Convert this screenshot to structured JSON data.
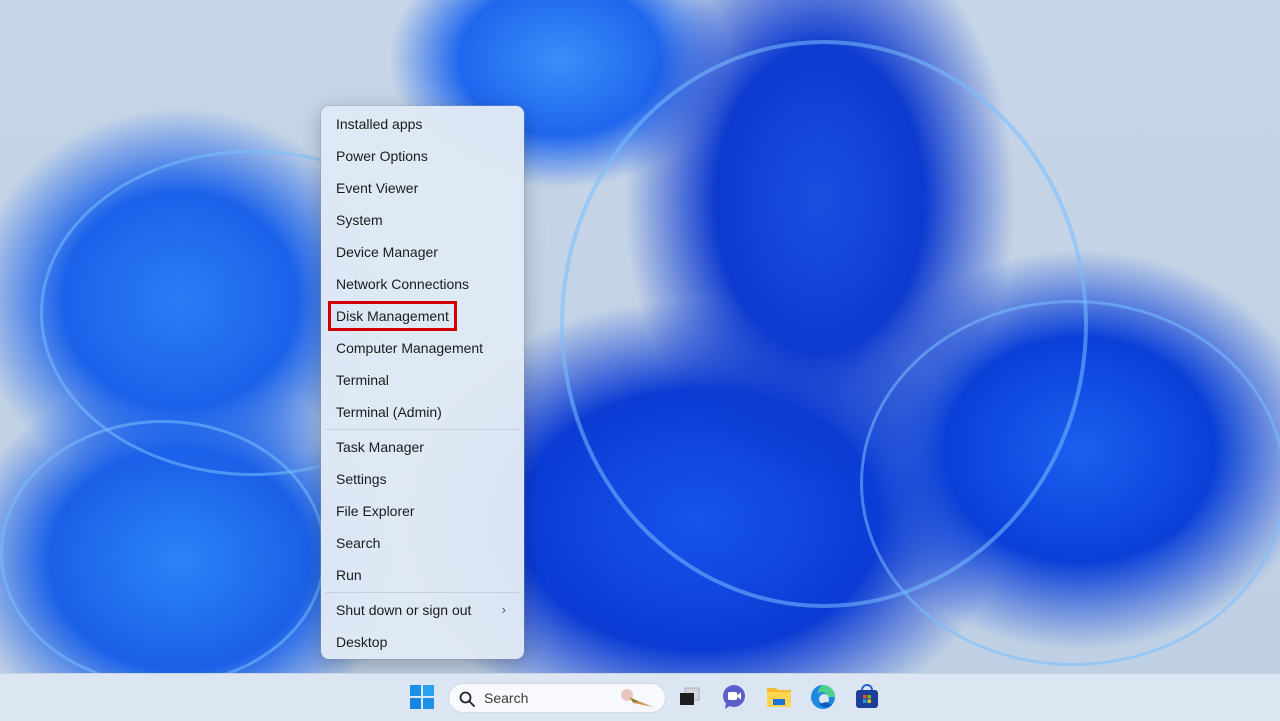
{
  "context_menu": {
    "items": [
      {
        "label": "Installed apps"
      },
      {
        "label": "Power Options"
      },
      {
        "label": "Event Viewer"
      },
      {
        "label": "System"
      },
      {
        "label": "Device Manager"
      },
      {
        "label": "Network Connections"
      },
      {
        "label": "Disk Management",
        "highlighted": true
      },
      {
        "label": "Computer Management"
      },
      {
        "label": "Terminal"
      },
      {
        "label": "Terminal (Admin)"
      },
      {
        "label": "Task Manager"
      },
      {
        "label": "Settings"
      },
      {
        "label": "File Explorer"
      },
      {
        "label": "Search"
      },
      {
        "label": "Run"
      },
      {
        "label": "Shut down or sign out",
        "submenu": true
      },
      {
        "label": "Desktop"
      }
    ],
    "submenu_chevron": "›",
    "highlight_color": "#d40000"
  },
  "taskbar": {
    "search": {
      "placeholder": "Search"
    },
    "icons": [
      "start-icon",
      "search-icon",
      "task-view-icon",
      "teams-chat-icon",
      "file-explorer-icon",
      "edge-icon",
      "store-icon"
    ]
  }
}
